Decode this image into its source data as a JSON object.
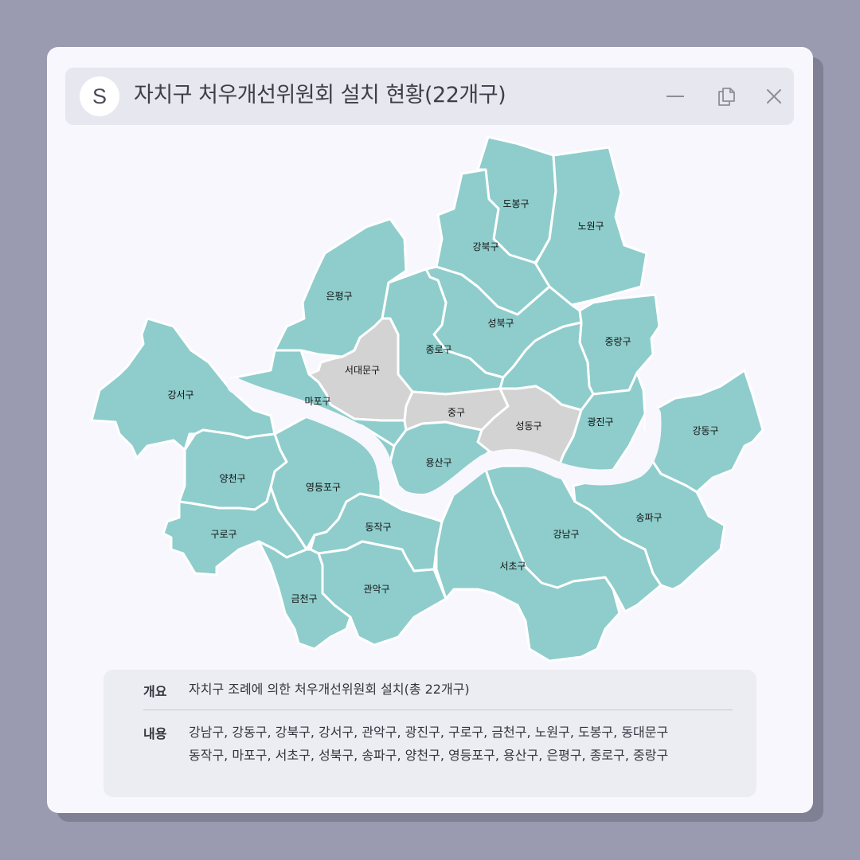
{
  "window": {
    "logo": "S",
    "title": "자치구 처우개선위원회 설치 현황(22개구)",
    "controls": [
      "minimize-icon",
      "copy-icon",
      "close-icon"
    ]
  },
  "colors": {
    "installed": "#8ecdcc",
    "not_installed": "#d3d3d3",
    "background": "#9a9bb0"
  },
  "map": {
    "districts": [
      {
        "name": "도봉구",
        "installed": true
      },
      {
        "name": "노원구",
        "installed": true
      },
      {
        "name": "강북구",
        "installed": true
      },
      {
        "name": "은평구",
        "installed": true
      },
      {
        "name": "성북구",
        "installed": true
      },
      {
        "name": "중랑구",
        "installed": true
      },
      {
        "name": "종로구",
        "installed": true
      },
      {
        "name": "서대문구",
        "installed": false
      },
      {
        "name": "강서구",
        "installed": true
      },
      {
        "name": "마포구",
        "installed": true
      },
      {
        "name": "중구",
        "installed": false
      },
      {
        "name": "성동구",
        "installed": false
      },
      {
        "name": "광진구",
        "installed": true
      },
      {
        "name": "강동구",
        "installed": true
      },
      {
        "name": "용산구",
        "installed": true
      },
      {
        "name": "양천구",
        "installed": true
      },
      {
        "name": "영등포구",
        "installed": true
      },
      {
        "name": "송파구",
        "installed": true
      },
      {
        "name": "구로구",
        "installed": true
      },
      {
        "name": "동작구",
        "installed": true
      },
      {
        "name": "강남구",
        "installed": true
      },
      {
        "name": "서초구",
        "installed": true
      },
      {
        "name": "관악구",
        "installed": true
      },
      {
        "name": "금천구",
        "installed": true
      }
    ]
  },
  "info": {
    "overview_label": "개요",
    "overview_value": "자치구 조례에 의한 처우개선위원회 설치(총 22개구)",
    "content_label": "내용",
    "content_line1": "강남구, 강동구, 강북구, 강서구, 관악구, 광진구, 구로구, 금천구, 노원구, 도봉구, 동대문구",
    "content_line2": "동작구, 마포구, 서초구, 성북구, 송파구, 양천구, 영등포구, 용산구, 은평구, 종로구, 중랑구"
  }
}
